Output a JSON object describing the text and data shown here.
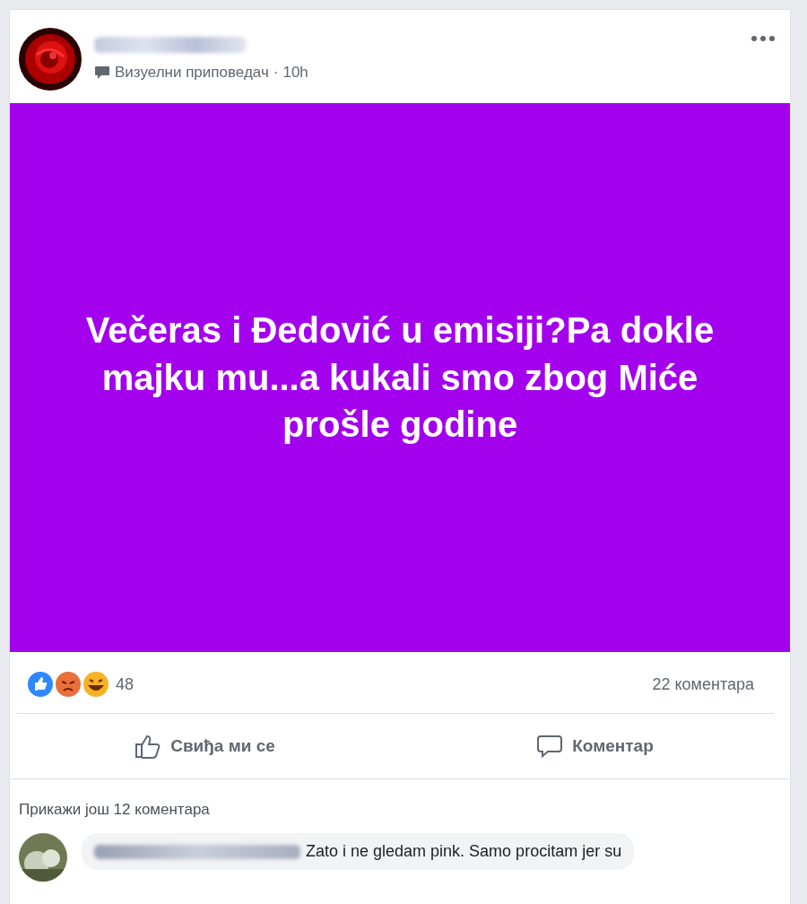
{
  "post": {
    "source": "Визуелни приповедач",
    "separator": "·",
    "time": "10h",
    "text": "Večeras i Đedović u emisiji?Pa dokle majku mu...a kukali smo zbog Miće prošle godine",
    "reaction_count": "48",
    "comment_count": "22 коментара"
  },
  "actions": [
    {
      "kind": "like",
      "label": "Свиђа ми се"
    },
    {
      "kind": "comment",
      "label": "Коментар"
    }
  ],
  "more_comments": "Прикажи још 12 коментара",
  "comments": [
    {
      "text": "Zato i ne gledam pink. Samo procitam jer su"
    }
  ]
}
